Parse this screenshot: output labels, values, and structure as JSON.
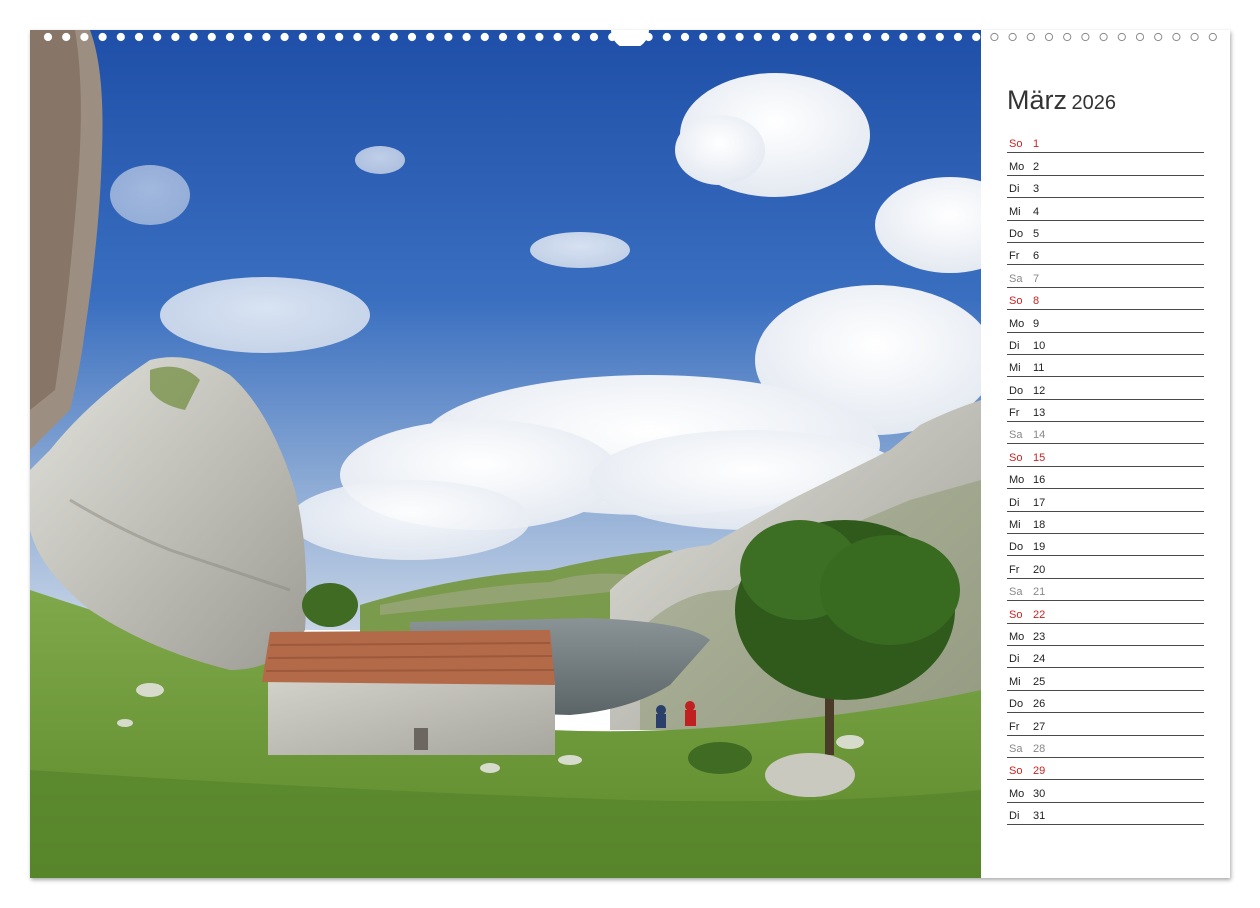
{
  "calendar": {
    "month": "März",
    "year": "2026",
    "days": [
      {
        "wd": "So",
        "d": "1",
        "type": "sun"
      },
      {
        "wd": "Mo",
        "d": "2",
        "type": "work"
      },
      {
        "wd": "Di",
        "d": "3",
        "type": "work"
      },
      {
        "wd": "Mi",
        "d": "4",
        "type": "work"
      },
      {
        "wd": "Do",
        "d": "5",
        "type": "work"
      },
      {
        "wd": "Fr",
        "d": "6",
        "type": "work"
      },
      {
        "wd": "Sa",
        "d": "7",
        "type": "sat"
      },
      {
        "wd": "So",
        "d": "8",
        "type": "sun"
      },
      {
        "wd": "Mo",
        "d": "9",
        "type": "work"
      },
      {
        "wd": "Di",
        "d": "10",
        "type": "work"
      },
      {
        "wd": "Mi",
        "d": "11",
        "type": "work"
      },
      {
        "wd": "Do",
        "d": "12",
        "type": "work"
      },
      {
        "wd": "Fr",
        "d": "13",
        "type": "work"
      },
      {
        "wd": "Sa",
        "d": "14",
        "type": "sat"
      },
      {
        "wd": "So",
        "d": "15",
        "type": "sun"
      },
      {
        "wd": "Mo",
        "d": "16",
        "type": "work"
      },
      {
        "wd": "Di",
        "d": "17",
        "type": "work"
      },
      {
        "wd": "Mi",
        "d": "18",
        "type": "work"
      },
      {
        "wd": "Do",
        "d": "19",
        "type": "work"
      },
      {
        "wd": "Fr",
        "d": "20",
        "type": "work"
      },
      {
        "wd": "Sa",
        "d": "21",
        "type": "sat"
      },
      {
        "wd": "So",
        "d": "22",
        "type": "sun"
      },
      {
        "wd": "Mo",
        "d": "23",
        "type": "work"
      },
      {
        "wd": "Di",
        "d": "24",
        "type": "work"
      },
      {
        "wd": "Mi",
        "d": "25",
        "type": "work"
      },
      {
        "wd": "Do",
        "d": "26",
        "type": "work"
      },
      {
        "wd": "Fr",
        "d": "27",
        "type": "work"
      },
      {
        "wd": "Sa",
        "d": "28",
        "type": "sat"
      },
      {
        "wd": "So",
        "d": "29",
        "type": "sun"
      },
      {
        "wd": "Mo",
        "d": "30",
        "type": "work"
      },
      {
        "wd": "Di",
        "d": "31",
        "type": "work"
      }
    ]
  },
  "colors": {
    "sunday": "#cc2222",
    "saturday": "#888888",
    "weekday": "#222222",
    "sky": "#2f5fb0",
    "meadow": "#6e9a3a"
  },
  "photo": {
    "subject": "mountain lake landscape with stone hut, tree and limestone cliffs"
  }
}
